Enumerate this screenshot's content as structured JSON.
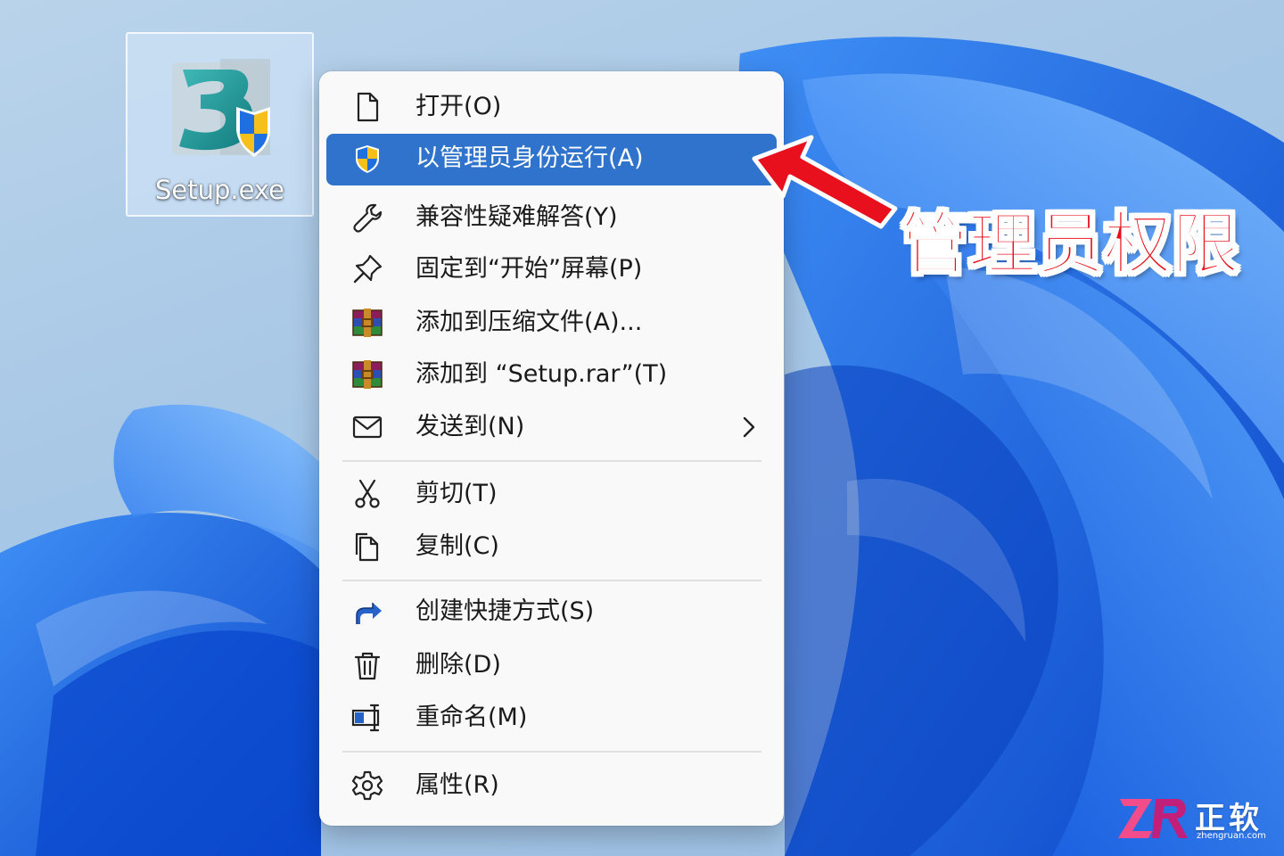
{
  "desktop": {
    "icon": {
      "label": "Setup.exe",
      "icon_name": "installer-3-with-uac-shield-icon"
    }
  },
  "context_menu": {
    "groups": [
      [
        {
          "label": "打开(O)",
          "icon": "open-file-icon"
        },
        {
          "label": "以管理员身份运行(A)",
          "icon": "uac-shield-icon",
          "highlighted": true
        },
        {
          "label": "兼容性疑难解答(Y)",
          "icon": "wrench-icon"
        },
        {
          "label": "固定到“开始”屏幕(P)",
          "icon": "pin-icon"
        },
        {
          "label": "添加到压缩文件(A)...",
          "icon": "winrar-icon"
        },
        {
          "label": "添加到 “Setup.rar”(T)",
          "icon": "winrar-icon"
        },
        {
          "label": "发送到(N)",
          "icon": "envelope-icon",
          "has_submenu": true
        }
      ],
      [
        {
          "label": "剪切(T)",
          "icon": "scissors-icon"
        },
        {
          "label": "复制(C)",
          "icon": "copy-icon"
        }
      ],
      [
        {
          "label": "创建快捷方式(S)",
          "icon": "shortcut-arrow-icon"
        },
        {
          "label": "删除(D)",
          "icon": "trash-icon"
        },
        {
          "label": "重命名(M)",
          "icon": "rename-icon"
        }
      ],
      [
        {
          "label": "属性(R)",
          "icon": "gear-icon"
        }
      ]
    ]
  },
  "annotation": {
    "text": "管理员权限",
    "color": "#e8101c"
  },
  "watermark": {
    "logo_text": "ZR",
    "brand": "正软",
    "url": "zhengruan.com"
  },
  "colors": {
    "highlight": "#2f73cc",
    "wallpaper_blue": "#1565e6",
    "menu_bg": "#f9f9f9"
  }
}
